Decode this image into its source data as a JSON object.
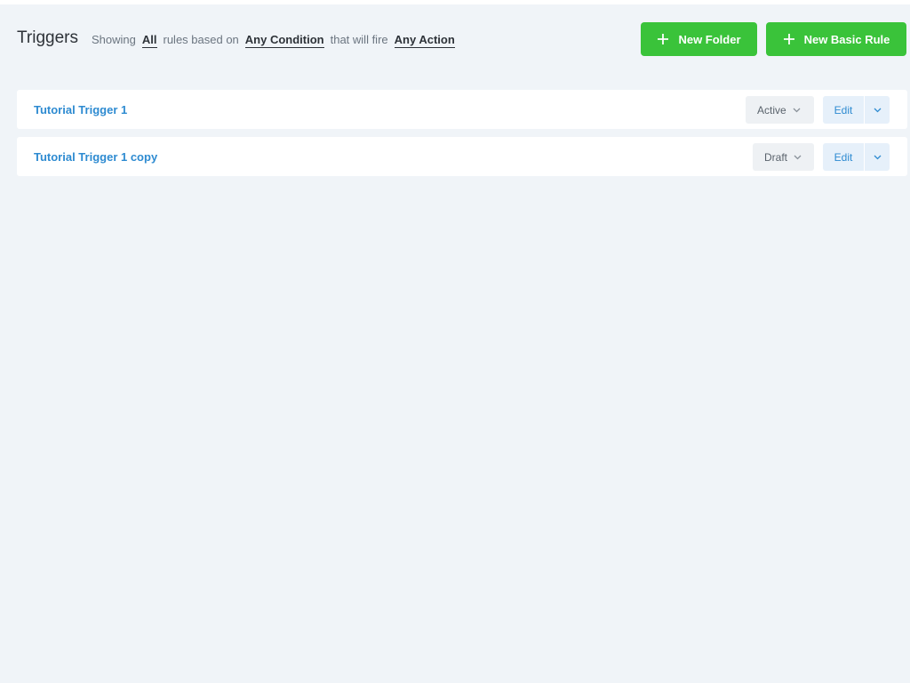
{
  "header": {
    "title": "Triggers",
    "filter": {
      "showing_label": "Showing",
      "scope_value": "All",
      "rules_based_on_label": "rules based on",
      "condition_value": "Any Condition",
      "that_will_fire_label": "that will fire",
      "action_value": "Any Action"
    },
    "new_folder_label": "New Folder",
    "new_basic_rule_label": "New Basic Rule"
  },
  "rules": [
    {
      "name": "Tutorial Trigger 1",
      "status": "Active",
      "edit_label": "Edit"
    },
    {
      "name": "Tutorial Trigger 1 copy",
      "status": "Draft",
      "edit_label": "Edit"
    }
  ],
  "colors": {
    "accent_green": "#3ac33a",
    "link_blue": "#2e8bd1",
    "background": "#f0f4f8"
  },
  "icons": {
    "add": "plus-icon",
    "dropdown": "chevron-down-icon"
  }
}
